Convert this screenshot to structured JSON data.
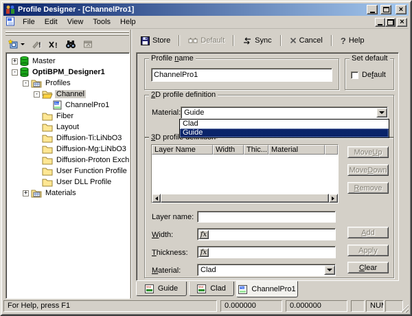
{
  "colors": {
    "titlebar_start": "#0a246a",
    "titlebar_end": "#a6caf0",
    "selection": "#0a246a",
    "face": "#d4d0c8"
  },
  "window": {
    "title": "Profile Designer - [ChannelPro1]"
  },
  "menubar": {
    "items": [
      "File",
      "Edit",
      "View",
      "Tools",
      "Help"
    ]
  },
  "app_toolbar": {
    "icons": [
      "new-profile-icon",
      "modify-icon",
      "delete-icon",
      "find-icon",
      "properties-icon"
    ]
  },
  "right_toolbar": {
    "store": "Store",
    "default": "Default",
    "sync": "Sync",
    "cancel": "Cancel",
    "help": "Help"
  },
  "tree": {
    "items": [
      {
        "label": "Master",
        "expander": "+",
        "icon": "database-icon"
      },
      {
        "label": "OptiBPM_Designer1",
        "expander": "-",
        "icon": "database-icon"
      },
      {
        "label": "Profiles",
        "expander": "-",
        "icon": "folder-grid-icon"
      },
      {
        "label": "Channel",
        "expander": "-",
        "icon": "folder-open-icon"
      },
      {
        "label": "ChannelPro1",
        "expander": "",
        "icon": "profile-doc-icon"
      },
      {
        "label": "Fiber",
        "expander": "",
        "icon": "folder-icon"
      },
      {
        "label": "Layout",
        "expander": "",
        "icon": "folder-icon"
      },
      {
        "label": "Diffusion-Ti:LiNbO3",
        "expander": "",
        "icon": "folder-icon"
      },
      {
        "label": "Diffusion-Mg:LiNbO3",
        "expander": "",
        "icon": "folder-icon"
      },
      {
        "label": "Diffusion-Proton Excha",
        "expander": "",
        "icon": "folder-icon"
      },
      {
        "label": "User Function Profile",
        "expander": "",
        "icon": "folder-icon"
      },
      {
        "label": "User DLL Profile",
        "expander": "",
        "icon": "folder-icon"
      },
      {
        "label": "Materials",
        "expander": "+",
        "icon": "folder-grid-icon"
      }
    ]
  },
  "profile": {
    "name_group": {
      "pre": "Profile ",
      "mn": "n",
      "post": "ame"
    },
    "name_value": "ChannelPro1",
    "set_default_group": "Set default",
    "default_checkbox": {
      "pre": "De",
      "mn": "f",
      "post": "ault"
    }
  },
  "profile2d": {
    "group": {
      "pre": "",
      "mn": "2",
      "post": "D profile definition"
    },
    "material_label": "Material:",
    "material_value": "Guide",
    "options": [
      {
        "label": "Clad"
      },
      {
        "label": "Guide"
      }
    ]
  },
  "profile3d": {
    "group": {
      "pre": "",
      "mn": "3",
      "post": "D profile definition"
    },
    "headers": [
      "Layer Name",
      "Width",
      "Thic...",
      "Material"
    ],
    "move_up": {
      "pre": "Move ",
      "mn": "U",
      "post": "p"
    },
    "move_down": {
      "pre": "Move ",
      "mn": "D",
      "post": "own"
    },
    "remove": {
      "pre": "",
      "mn": "R",
      "post": "emove"
    },
    "layer_name_label": "Layer name:",
    "layer_name_value": "",
    "width_label": {
      "pre": "",
      "mn": "W",
      "post": "idth:"
    },
    "width_value": "",
    "thickness_label": {
      "pre": "",
      "mn": "T",
      "post": "hickness:"
    },
    "thickness_value": "",
    "material_label": {
      "pre": "",
      "mn": "M",
      "post": "aterial:"
    },
    "material_value": "Clad",
    "fx": "fx",
    "add": {
      "pre": "",
      "mn": "A",
      "post": "dd"
    },
    "apply": "Apply",
    "clear": {
      "pre": "",
      "mn": "C",
      "post": "lear"
    }
  },
  "tabs": [
    {
      "label": "Guide",
      "icon": "material-doc-icon"
    },
    {
      "label": "Clad",
      "icon": "material-doc-icon"
    },
    {
      "label": "ChannelPro1",
      "icon": "profile-doc-icon"
    }
  ],
  "statusbar": {
    "message": "For Help, press F1",
    "coord_x": "0.000000",
    "coord_y": "0.000000",
    "num": "NUM"
  }
}
